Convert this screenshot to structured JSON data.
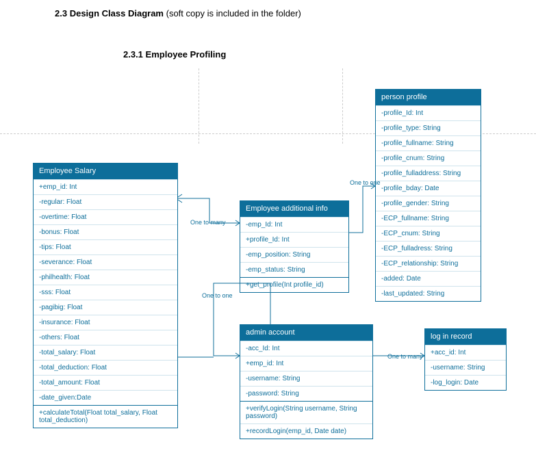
{
  "heading": {
    "number": "2.3",
    "title": "Design Class Diagram",
    "note": "(soft copy is included in the folder)"
  },
  "subheading": {
    "number": "2.3.1",
    "title": "Employee Profiling"
  },
  "classes": {
    "salary": {
      "name": "Employee Salary",
      "attrs": [
        "+emp_id: Int",
        "-regular: Float",
        "-overtime: Float",
        "-bonus: Float",
        "-tips: Float",
        "-severance: Float",
        "-philhealth: Float",
        "-sss: Float",
        "-pagibig: Float",
        "-insurance: Float",
        "-others: Float",
        "-total_salary: Float",
        "-total_deduction: Float",
        "-total_amount: Float",
        "-date_given:Date"
      ],
      "ops": [
        "+calculateTotal(Float total_salary, Float total_deduction)"
      ]
    },
    "addinfo": {
      "name": "Employee additional info",
      "attrs": [
        "-emp_Id: Int",
        "+profile_Id: Int",
        "-emp_position: String",
        "-emp_status: String"
      ],
      "ops": [
        "+get_profile(Int profile_id)"
      ]
    },
    "profile": {
      "name": "person profile",
      "attrs": [
        "-profile_Id: Int",
        "-profile_type: String",
        "-profile_fullname: String",
        "-profile_cnum: String",
        "-profile_fulladdress: String",
        "-profile_bday: Date",
        "-profile_gender: String",
        "-ECP_fullname: String",
        "-ECP_cnum: String",
        "-ECP_fulladress: String",
        "-ECP_relationship: String",
        "-added: Date",
        "-last_updated: String"
      ]
    },
    "admin": {
      "name": "admin account",
      "attrs": [
        "-acc_Id: Int",
        "+emp_id: Int",
        "-username: String",
        "-password: String"
      ],
      "ops": [
        "+verifyLogin(String username, String password)",
        "+recordLogin(emp_id, Date date)"
      ]
    },
    "log": {
      "name": "log in record",
      "attrs": [
        "+acc_id: Int",
        "-username: String",
        "-log_login: Date"
      ]
    }
  },
  "labels": {
    "one_to_many": "One to many",
    "one_to_one": "One to one"
  }
}
